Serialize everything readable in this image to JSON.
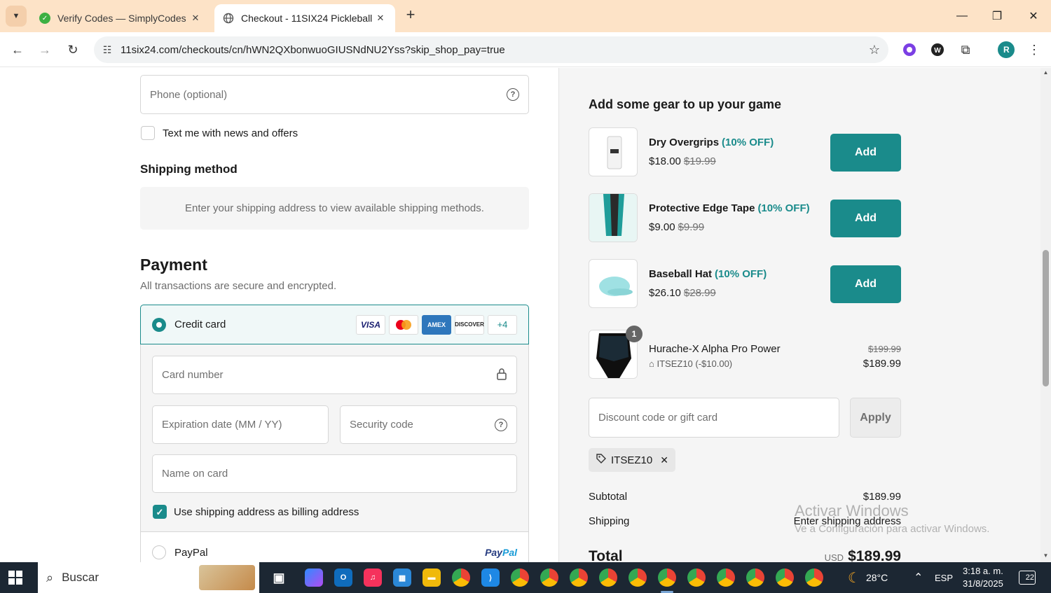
{
  "browser": {
    "tabs": [
      {
        "title": "Verify Codes — SimplyCodes",
        "favicon": "simplycodes-icon",
        "active": false
      },
      {
        "title": "Checkout - 11SIX24 Pickleball",
        "favicon": "globe-icon",
        "active": true
      }
    ],
    "url": "11six24.com/checkouts/cn/hWN2QXbonwuoGIUSNdNU2Yss?skip_shop_pay=true",
    "profile_initial": "R"
  },
  "contact": {
    "phone_placeholder": "Phone (optional)",
    "text_offers_label": "Text me with news and offers"
  },
  "shipping": {
    "heading": "Shipping method",
    "message": "Enter your shipping address to view available shipping methods."
  },
  "payment": {
    "heading": "Payment",
    "subtitle": "All transactions are secure and encrypted.",
    "credit_card_label": "Credit card",
    "card_brands": [
      "VISA",
      "MC",
      "AMEX",
      "DISCOVER"
    ],
    "more_brands": "+4",
    "card_number_placeholder": "Card number",
    "expiry_placeholder": "Expiration date (MM / YY)",
    "security_placeholder": "Security code",
    "name_placeholder": "Name on card",
    "billing_same_label": "Use shipping address as billing address",
    "billing_same_checked": true,
    "paypal_label": "PayPal",
    "paypal_logo_a": "Pay",
    "paypal_logo_b": "Pal"
  },
  "upsell": {
    "heading": "Add some gear to up your game",
    "add_label": "Add",
    "items": [
      {
        "name": "Dry Overgrips",
        "discount": "(10% OFF)",
        "price": "$18.00",
        "original": "$19.99"
      },
      {
        "name": "Protective Edge Tape",
        "discount": "(10% OFF)",
        "price": "$9.00",
        "original": "$9.99"
      },
      {
        "name": "Baseball Hat",
        "discount": "(10% OFF)",
        "price": "$26.10",
        "original": "$28.99"
      }
    ]
  },
  "cart": {
    "item_name": "Hurache-X Alpha Pro Power",
    "quantity": "1",
    "discount_line": "ITSEZ10 (-$10.00)",
    "original_price": "$199.99",
    "price": "$189.99"
  },
  "discount": {
    "placeholder": "Discount code or gift card",
    "apply_label": "Apply",
    "applied_code": "ITSEZ10"
  },
  "summary": {
    "subtotal_label": "Subtotal",
    "subtotal_value": "$189.99",
    "shipping_label": "Shipping",
    "shipping_value": "Enter shipping address",
    "total_label": "Total",
    "currency": "USD",
    "total_value": "$189.99"
  },
  "watermark": {
    "line1": "Activar Windows",
    "line2": "Ve a Configuración para activar Windows."
  },
  "taskbar": {
    "search_label": "Buscar",
    "temperature": "28°C",
    "language": "ESP",
    "time": "3:18 a. m.",
    "date": "31/8/2025",
    "notifications": "22"
  },
  "colors": {
    "accent": "#1a8b8b",
    "tabstrip": "#fde3c7",
    "taskbar": "#1c2733"
  }
}
